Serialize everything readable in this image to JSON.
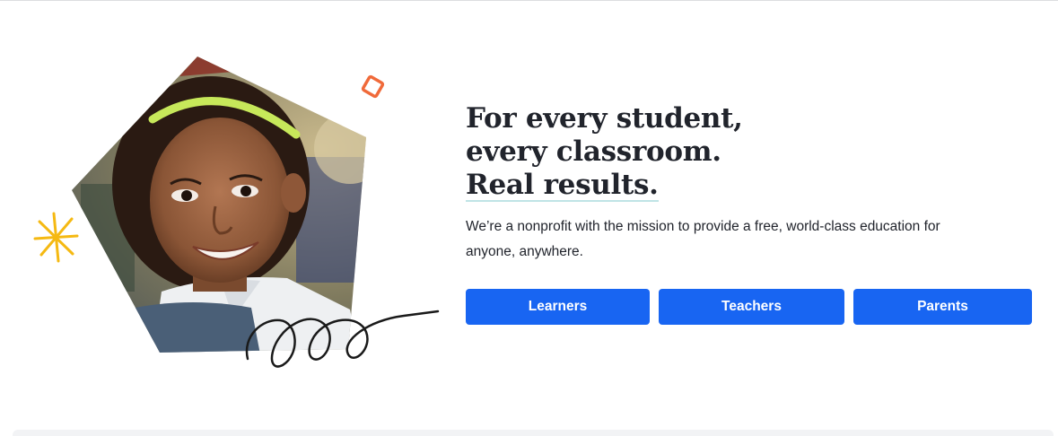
{
  "hero": {
    "headline_line_1": "For every student,",
    "headline_line_2": "every classroom.",
    "headline_line_3": "Real results.",
    "subheading": "We’re a nonprofit with the mission to provide a free, world-class education for anyone, anywhere.",
    "image_subject": "smiling-student-photo",
    "decorations": [
      "orange-diamond-icon",
      "yellow-spark-icon",
      "black-squiggle-icon"
    ]
  },
  "cta": {
    "learners_label": "Learners",
    "teachers_label": "Teachers",
    "parents_label": "Parents"
  },
  "colors": {
    "accent_blue": "#1865f2",
    "headline_text": "#21242c",
    "underline_teal": "#bfe4e6",
    "orange": "#f06a3a",
    "yellow": "#f5b912"
  }
}
